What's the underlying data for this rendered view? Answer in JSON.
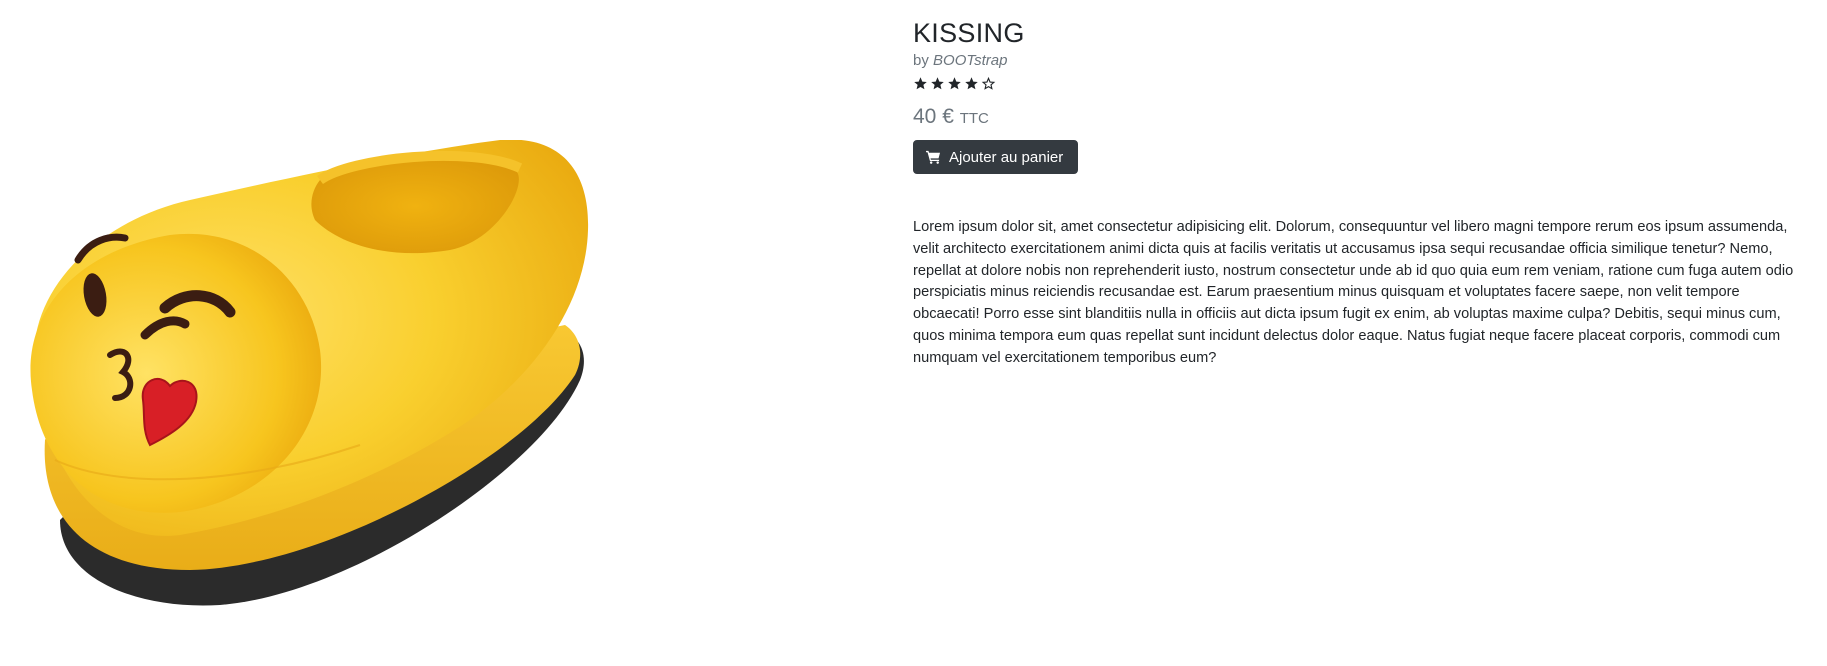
{
  "product": {
    "title": "KISSING",
    "by_prefix": "by",
    "brand": "BOOTstrap",
    "rating": {
      "value": 4,
      "max": 5
    },
    "price": "40 €",
    "price_suffix": "TTC",
    "add_to_cart_label": "Ajouter au panier",
    "image_alt": "Kissing emoji slipper",
    "description": "Lorem ipsum dolor sit, amet consectetur adipisicing elit. Dolorum, consequuntur vel libero magni tempore rerum eos ipsum assumenda, velit architecto exercitationem animi dicta quis at facilis veritatis ut accusamus ipsa sequi recusandae officia similique tenetur? Nemo, repellat at dolore nobis non reprehenderit iusto, nostrum consectetur unde ab id quo quia eum rem veniam, ratione cum fuga autem odio perspiciatis minus reiciendis recusandae est. Earum praesentium minus quisquam et voluptates facere saepe, non velit tempore obcaecati! Porro esse sint blanditiis nulla in officiis aut dicta ipsum fugit ex enim, ab voluptas maxime culpa? Debitis, sequi minus cum, quos minima tempora eum quas repellat sunt incidunt delectus dolor eaque. Natus fugiat neque facere placeat corporis, commodi cum numquam vel exercitationem temporibus eum?"
  },
  "icons": {
    "star_filled": "star-filled-icon",
    "star_empty": "star-empty-icon",
    "cart": "shopping-cart-icon"
  },
  "colors": {
    "button_bg": "#343a40",
    "muted_text": "#6c757d",
    "slipper_yellow": "#f7c51e",
    "heart_red": "#d81f26"
  }
}
